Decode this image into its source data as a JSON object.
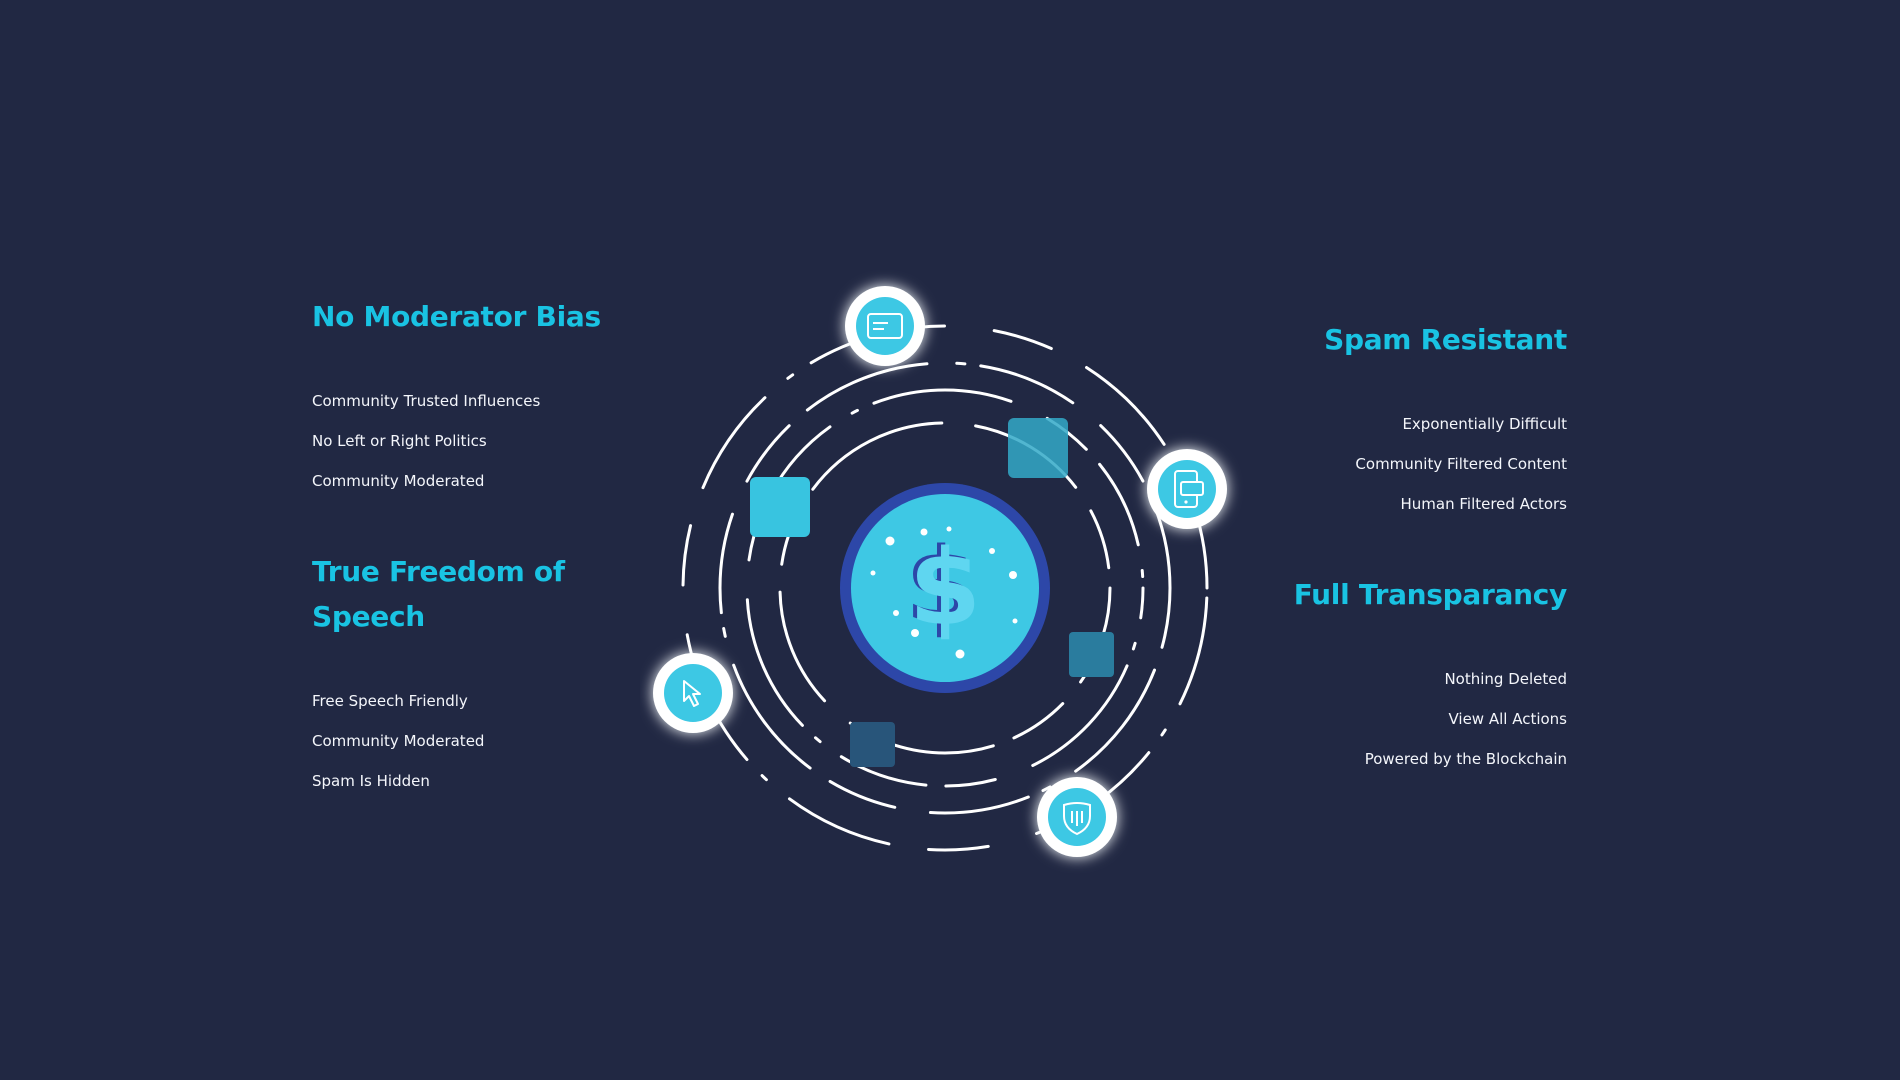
{
  "features": {
    "no_bias": {
      "title": "No Moderator Bias",
      "items": [
        "Community Trusted Influences",
        "No Left or Right Politics",
        "Community Moderated"
      ]
    },
    "freedom": {
      "title": "True Freedom of Speech",
      "items": [
        "Free Speech Friendly",
        "Community Moderated",
        "Spam Is Hidden"
      ]
    },
    "spam": {
      "title": "Spam Resistant",
      "items": [
        "Exponentially Difficult",
        "Community Filtered Content",
        "Human Filtered Actors"
      ]
    },
    "transparency": {
      "title": "Full Transparancy",
      "items": [
        "Nothing Deleted",
        "View All Actions",
        "Powered by the Blockchain"
      ]
    }
  },
  "graphic": {
    "center_icon": "dollar-coin-icon",
    "orbit_icons": [
      "wallet-card-icon",
      "mobile-wallet-icon",
      "cursor-icon",
      "shield-icon"
    ]
  },
  "colors": {
    "background": "#212843",
    "accent": "#19c3e3",
    "coin": "#3ec8e4",
    "coin_ring": "#2d47a8",
    "text": "#f4f6fb"
  }
}
